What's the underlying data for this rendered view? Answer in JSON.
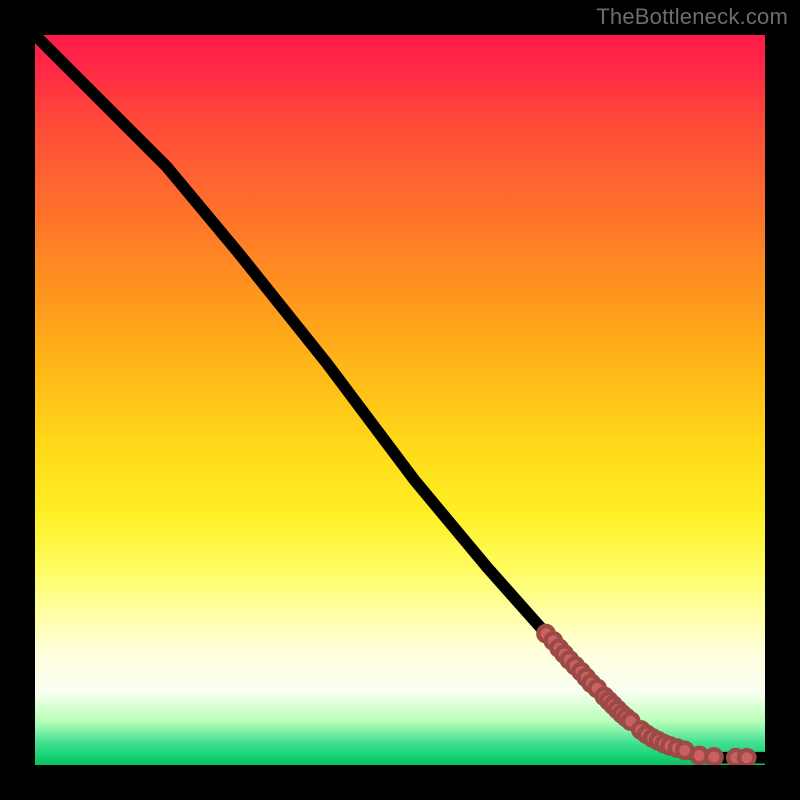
{
  "watermark_text": "TheBottleneck.com",
  "colors": {
    "page_bg": "#000000",
    "watermark": "#6d6d6d",
    "curve": "#000000",
    "marker_fill": "#c9615f",
    "marker_stroke": "#9c4a47"
  },
  "chart_data": {
    "type": "line",
    "title": "",
    "xlabel": "",
    "ylabel": "",
    "xlim": [
      0,
      100
    ],
    "ylim": [
      0,
      100
    ],
    "grid": false,
    "legend": false,
    "series": [
      {
        "name": "curve",
        "kind": "line",
        "x": [
          0,
          4,
          8,
          12,
          18,
          28,
          40,
          52,
          62,
          70,
          76,
          80,
          84,
          88,
          92,
          96,
          100
        ],
        "y": [
          100,
          96,
          92,
          88,
          82,
          70,
          55,
          39,
          27,
          18,
          11,
          7,
          4,
          2,
          1,
          1,
          1
        ]
      },
      {
        "name": "marker-cluster",
        "kind": "scatter",
        "x": [
          70,
          71,
          71.8,
          72.5,
          73.2,
          74,
          74.8,
          75.5,
          76.2,
          77,
          78,
          78.6,
          79.2,
          79.8,
          80.4,
          81,
          81.6,
          83,
          83.8,
          84.6,
          85.4,
          86.2,
          87,
          88,
          89,
          91,
          93,
          96,
          97.5
        ],
        "y": [
          18,
          17,
          16,
          15.2,
          14.4,
          13.6,
          12.8,
          12,
          11.2,
          10.5,
          9.4,
          8.8,
          8.2,
          7.6,
          7.0,
          6.5,
          6.0,
          4.8,
          4.2,
          3.7,
          3.3,
          2.9,
          2.6,
          2.3,
          2.0,
          1.3,
          1.1,
          1.0,
          1.0
        ]
      }
    ],
    "background_gradient_stops": [
      {
        "pos": 0.0,
        "color": "#ff1a4a"
      },
      {
        "pos": 0.22,
        "color": "#ff6a2e"
      },
      {
        "pos": 0.44,
        "color": "#ffb218"
      },
      {
        "pos": 0.66,
        "color": "#fff028"
      },
      {
        "pos": 0.85,
        "color": "#ffffe0"
      },
      {
        "pos": 0.97,
        "color": "#40e090"
      },
      {
        "pos": 1.0,
        "color": "#0ac060"
      }
    ]
  }
}
